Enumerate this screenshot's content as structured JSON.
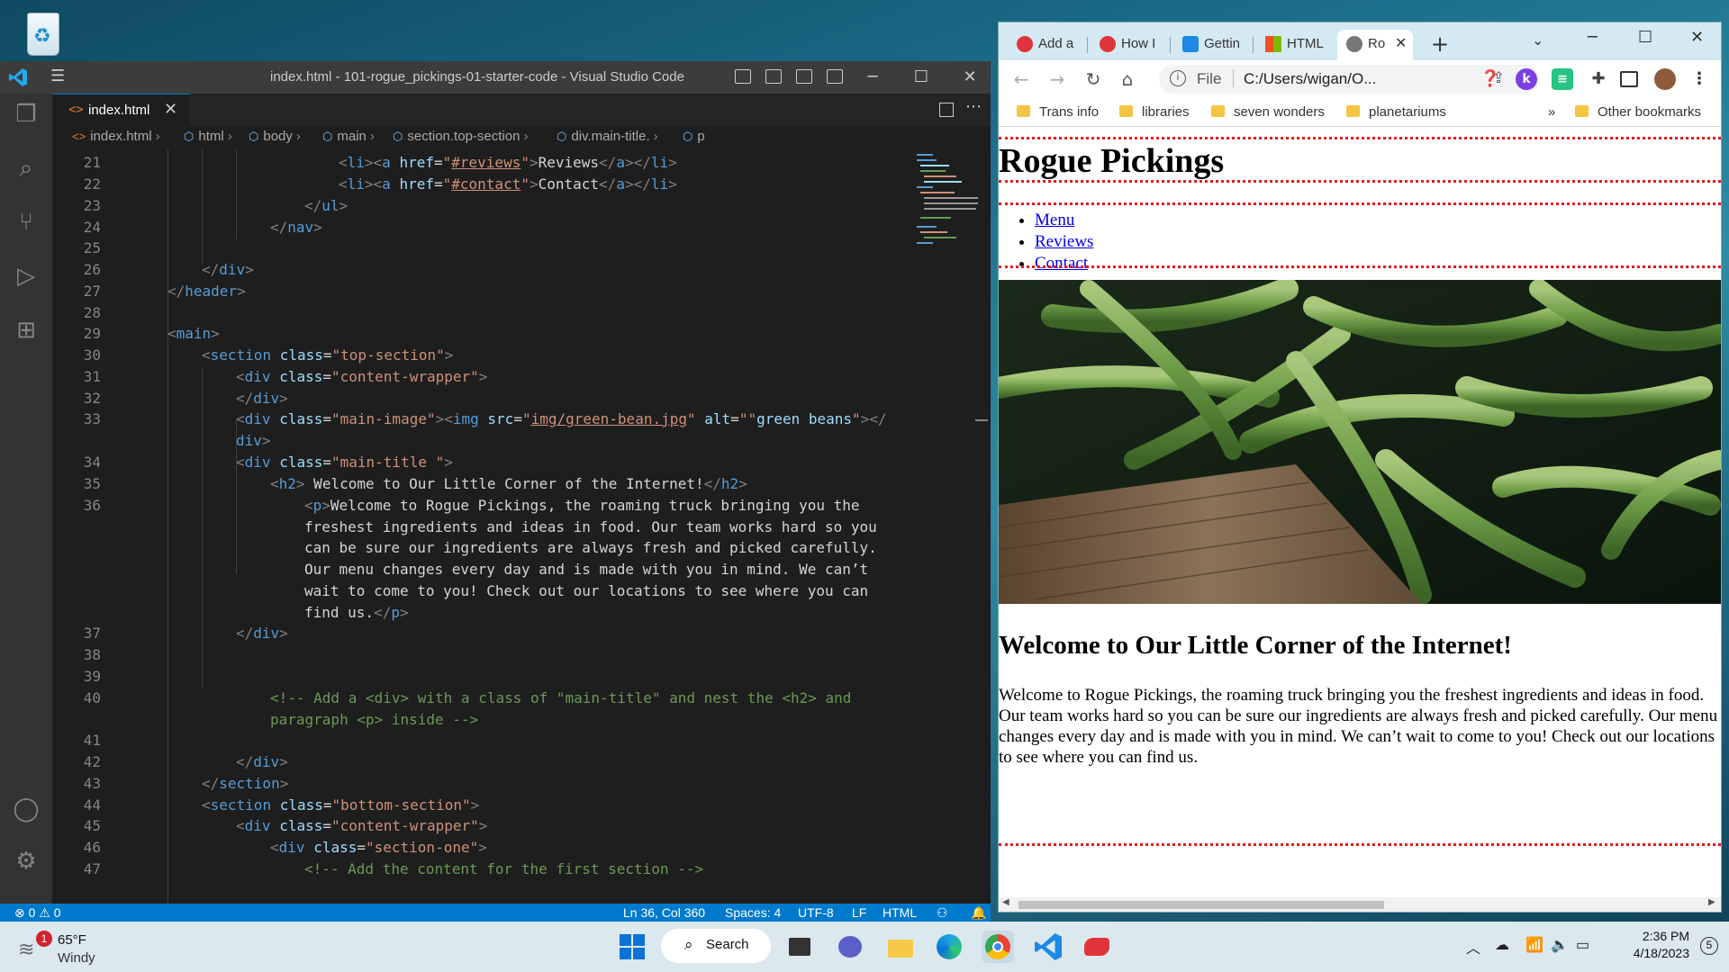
{
  "vscode": {
    "title": "index.html - 101-rogue_pickings-01-starter-code - Visual Studio Code",
    "tab_label": "index.html",
    "breadcrumb": [
      "index.html",
      "html",
      "body",
      "main",
      "section.top-section",
      "div.main-title.",
      "p"
    ],
    "status": {
      "errors": "0",
      "warnings": "0",
      "position": "Ln 36, Col 360",
      "spaces": "Spaces: 4",
      "encoding": "UTF-8",
      "eol": "LF",
      "language": "HTML"
    },
    "line_numbers": [
      "21",
      "22",
      "23",
      "24",
      "25",
      "26",
      "27",
      "28",
      "29",
      "30",
      "31",
      "32",
      "33",
      "",
      "34",
      "35",
      "36",
      "",
      "",
      "",
      "",
      "",
      "37",
      "38",
      "39",
      "40",
      "",
      "41",
      "42",
      "43",
      "44",
      "45",
      "46",
      "47"
    ]
  },
  "chrome": {
    "tabs": [
      "Add a",
      "How I",
      "Gettin",
      "HTML",
      "Ro"
    ],
    "address_prefix": "File",
    "address": "C:/Users/wigan/O...",
    "bookmarks": [
      "Trans info",
      "libraries",
      "seven wonders",
      "planetariums"
    ],
    "bookmarks_overflow": "»",
    "other_bookmarks": "Other bookmarks"
  },
  "page": {
    "site_title": "Rogue Pickings",
    "nav": [
      "Menu",
      "Reviews",
      "Contact"
    ],
    "hero_alt": "green beans",
    "welcome_heading": "Welcome to Our Little Corner of the Internet!",
    "welcome_text": "Welcome to Rogue Pickings, the roaming truck bringing you the freshest ingredients and ideas in food. Our team works hard so you can be sure our ingredients are always fresh and picked carefully. Our menu changes every day and is made with you in mind. We can’t wait to come to you! Check out our locations to see where you can find us."
  },
  "taskbar": {
    "weather_temp": "65°F",
    "weather_desc": "Windy",
    "weather_badge": "1",
    "search_label": "Search",
    "time": "2:36 PM",
    "date": "4/18/2023",
    "notification_count": "5"
  }
}
